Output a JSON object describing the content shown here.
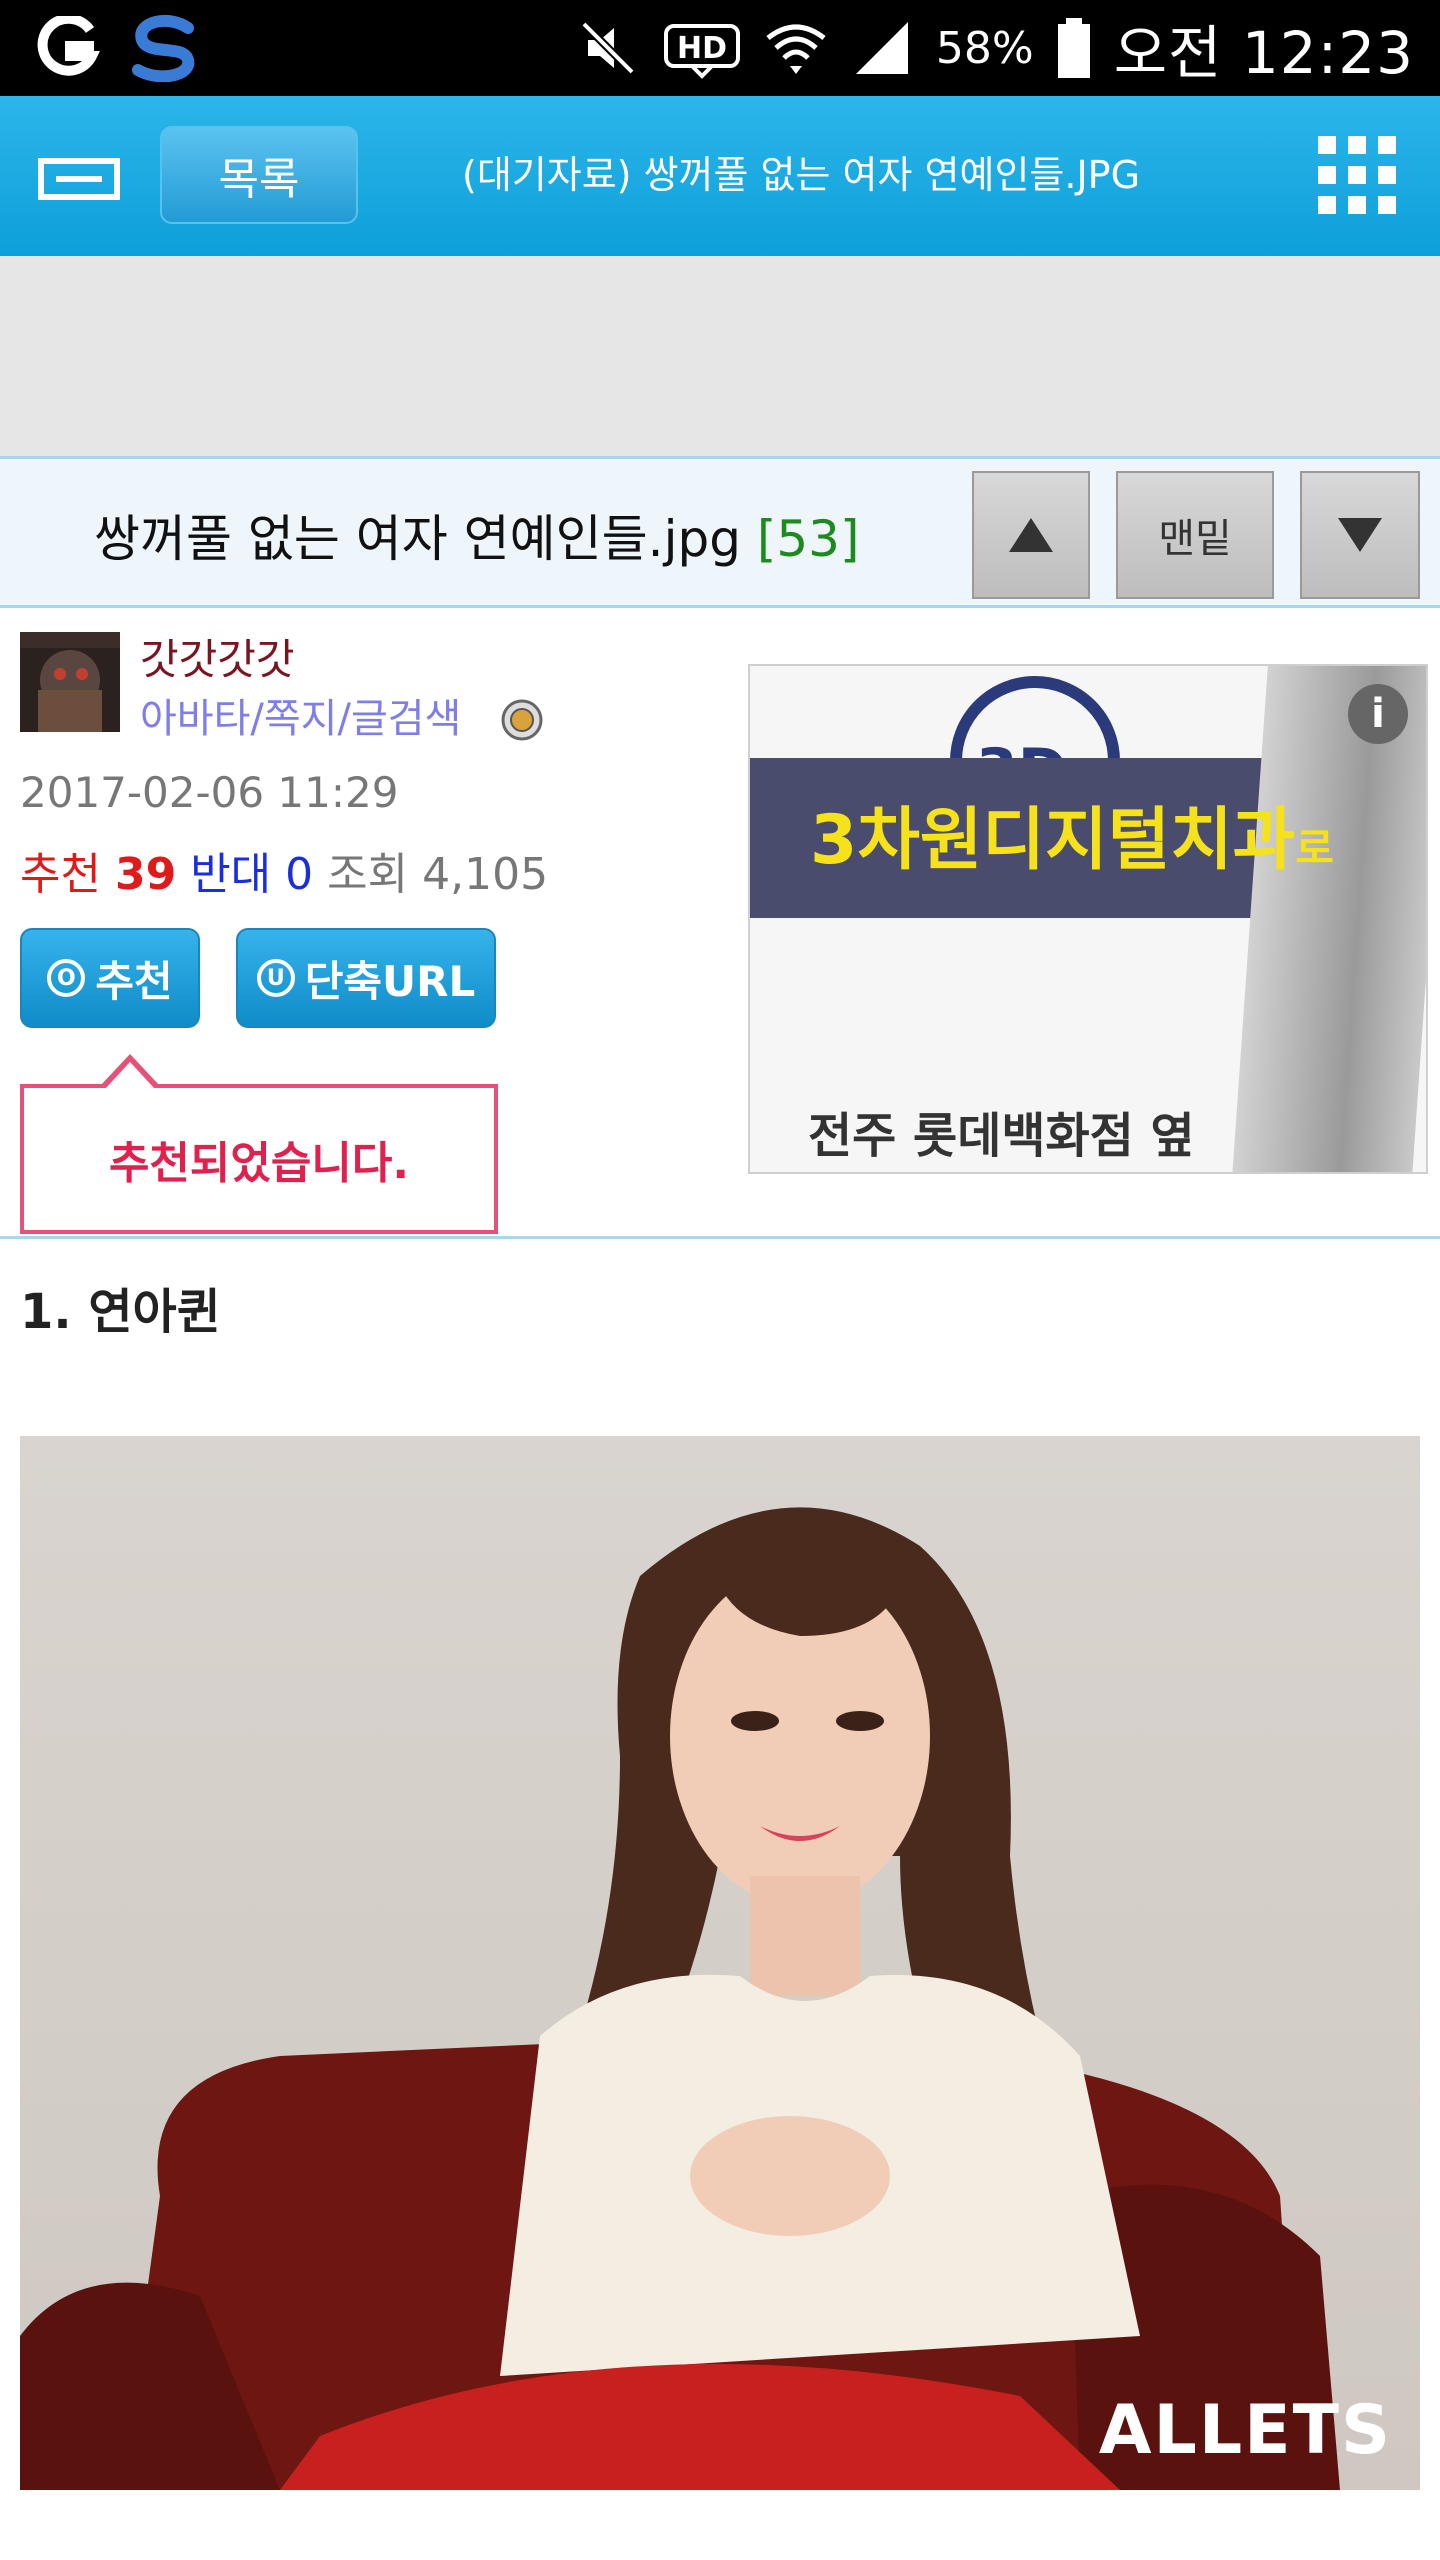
{
  "status_bar": {
    "battery_percent": "58%",
    "clock": "오전 12:23",
    "icons": [
      "g-app-icon",
      "s-app-icon",
      "mute-icon",
      "hd-icon",
      "wifi-icon",
      "signal-icon",
      "battery-icon"
    ]
  },
  "header": {
    "list_button": "목록",
    "title": "(대기자료) 쌍꺼풀 없는 여자 연예인들.JPG"
  },
  "post": {
    "title": "쌍꺼풀 없는 여자 연예인들.jpg",
    "comment_count": "[53]",
    "bottom_button": "맨밑",
    "author": {
      "name": "갓갓갓갓",
      "links": "아바타/쪽지/글검색"
    },
    "date": "2017-02-06 11:29",
    "stats": {
      "recommend_label": "추천",
      "recommend_value": "39",
      "oppose_label": "반대",
      "oppose_value": "0",
      "views_label": "조회",
      "views_value": "4,105"
    },
    "buttons": {
      "recommend": "추천",
      "recommend_badge": "O",
      "short_url": "단축URL",
      "short_url_badge": "U"
    },
    "tooltip": "추천되었습니다.",
    "section_heading": "1. 연아퀸",
    "photo_watermark": "ALLETS"
  },
  "ad": {
    "logo": "3D",
    "headline_main": "3차원디지털치과",
    "headline_suffix": "로",
    "subtext": "전주 롯데백화점 옆",
    "info": "i"
  },
  "colors": {
    "header_blue": "#0d9fd9",
    "recommend_red": "#e01a1a",
    "oppose_blue": "#1a2ee0",
    "comment_green": "#1d8a1d",
    "tooltip_pink": "#e6517a"
  }
}
